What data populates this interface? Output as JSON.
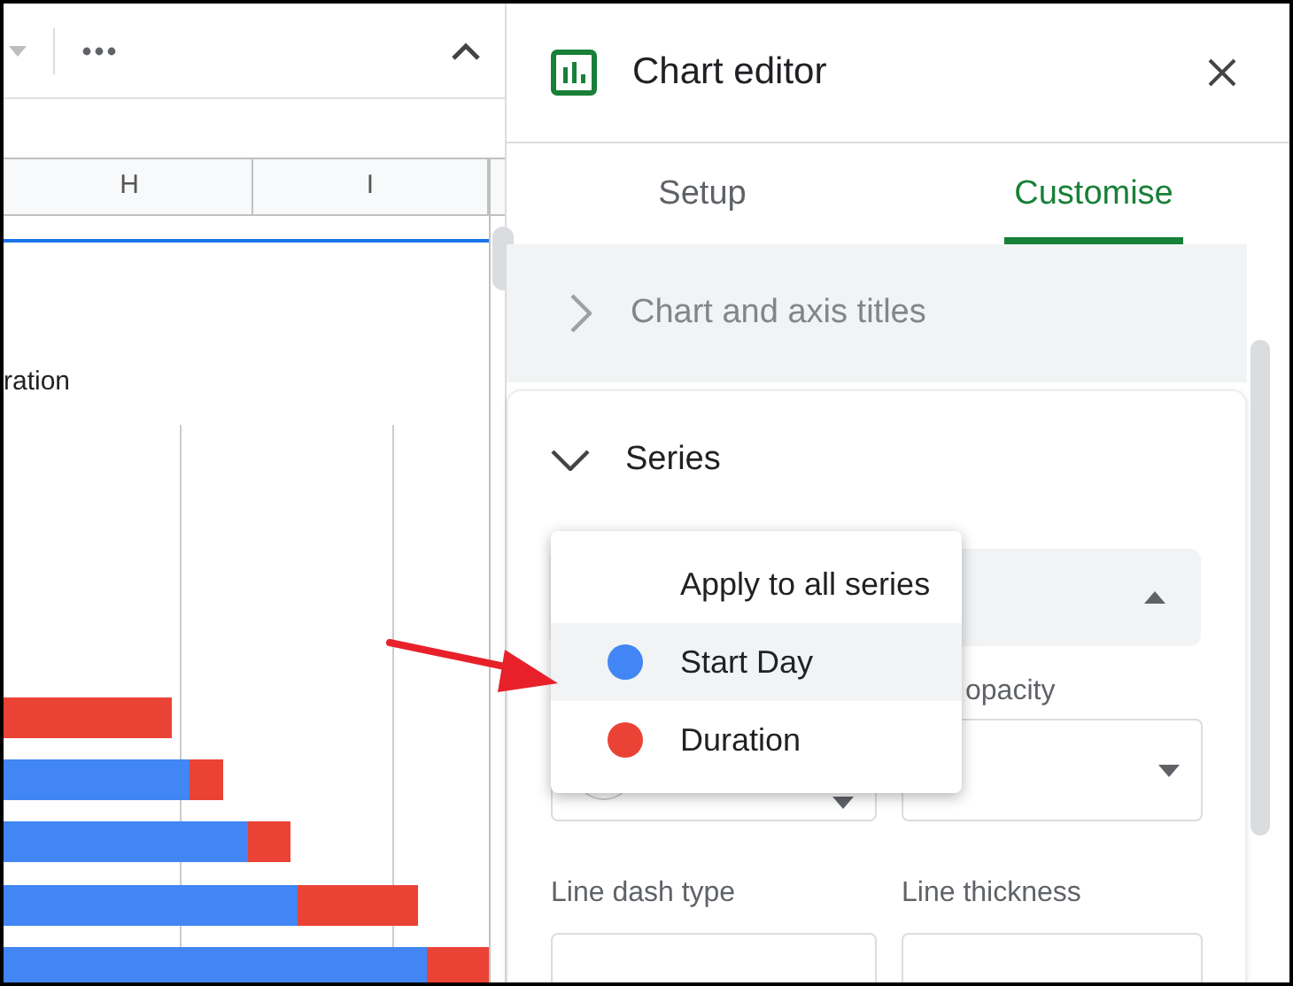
{
  "sheet": {
    "columns": [
      {
        "label": "H"
      },
      {
        "label": "I"
      }
    ],
    "chart_title": "ration"
  },
  "editor": {
    "title": "Chart editor",
    "tabs": [
      {
        "label": "Setup",
        "selected": false
      },
      {
        "label": "Customise",
        "selected": true
      }
    ],
    "sections": [
      {
        "label": "Chart and axis titles",
        "expanded": false
      },
      {
        "label": "Series",
        "expanded": true
      }
    ],
    "series_menu": {
      "items": [
        {
          "label": "Apply to all series",
          "selected": false
        },
        {
          "label": "Start Day",
          "color": "#4285f4",
          "selected": true
        },
        {
          "label": "Duration",
          "color": "#ea4335",
          "selected": false
        }
      ]
    },
    "opacity_label": "opacity",
    "fields_row2": [
      {
        "label": "Line dash type"
      },
      {
        "label": "Line thickness"
      }
    ]
  }
}
